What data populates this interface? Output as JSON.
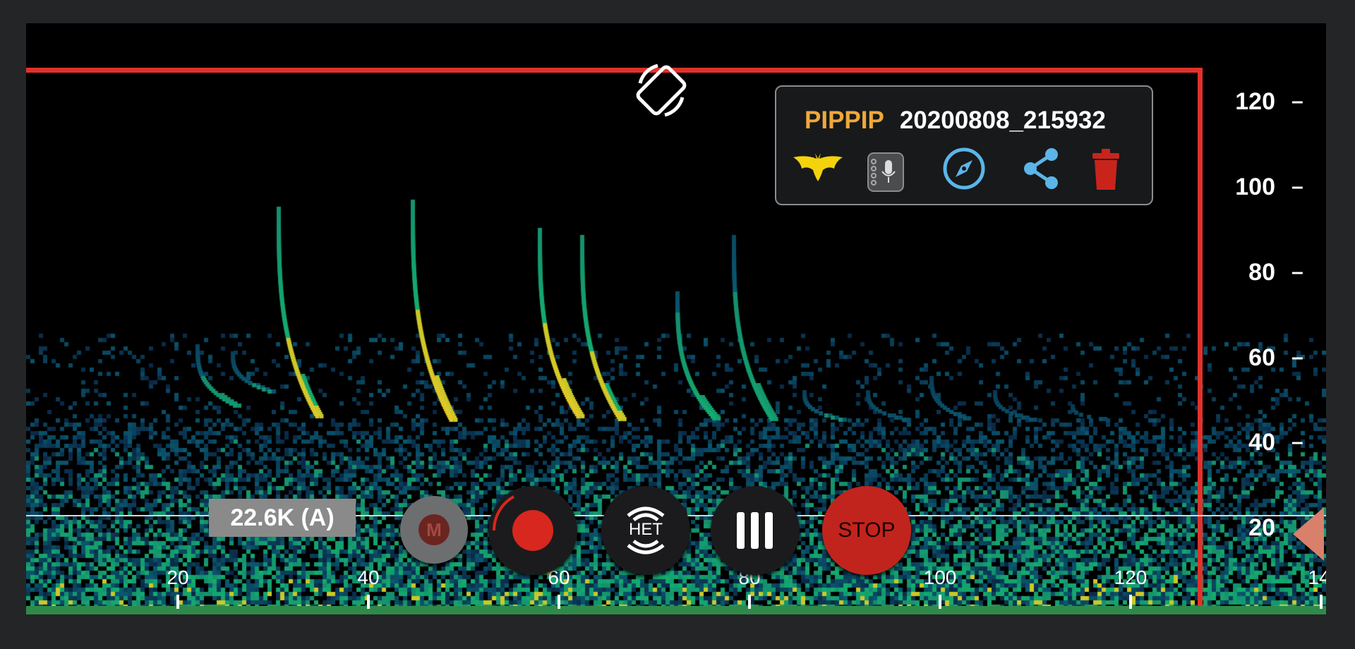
{
  "info": {
    "species": "PIPPIP",
    "filename": "20200808_215932"
  },
  "icons": {
    "rotate": "screen-rotate-icon",
    "bat": "bat-icon",
    "mic": "microphone-notebook-icon",
    "compass": "compass-icon",
    "share": "share-icon",
    "trash": "trash-icon"
  },
  "freq_badge": "22.6K (A)",
  "buttons": {
    "m_label": "M",
    "het_label": "HET",
    "stop_label": "STOP"
  },
  "y_axis": {
    "ticks": [
      "120",
      "100",
      "80",
      "60",
      "40",
      "20"
    ]
  },
  "x_axis": {
    "ticks": [
      "20",
      "40",
      "60",
      "80",
      "100",
      "120",
      "14"
    ]
  },
  "colors": {
    "accent": "#f0a83a",
    "marker": "#e0322b",
    "stop": "#c1241d",
    "icon_blue": "#5bb5e8"
  }
}
